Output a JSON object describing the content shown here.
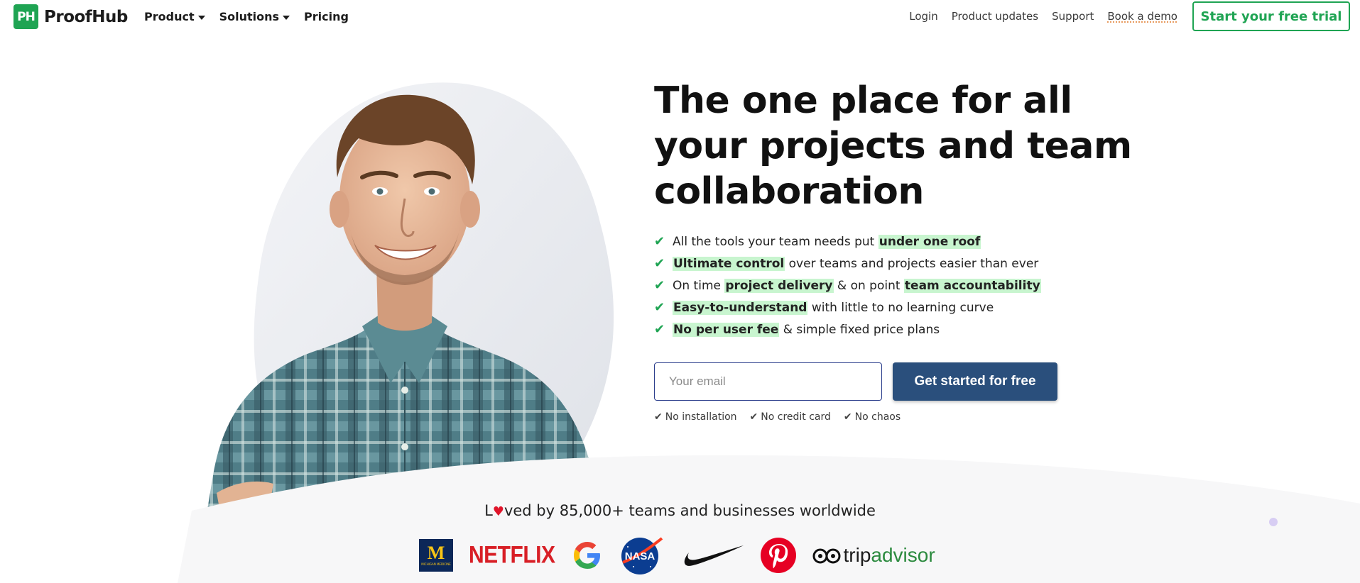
{
  "header": {
    "logo_mark": "PH",
    "logo_text": "ProofHub",
    "nav_left": [
      {
        "label": "Product",
        "has_menu": true
      },
      {
        "label": "Solutions",
        "has_menu": true
      },
      {
        "label": "Pricing",
        "has_menu": false
      }
    ],
    "nav_right": [
      "Login",
      "Product updates",
      "Support",
      "Book a demo"
    ],
    "trial_button": "Start your free trial"
  },
  "hero": {
    "headline": "The one place for all your projects and team collaboration",
    "features": [
      {
        "parts": [
          {
            "t": "All the tools your team needs put ",
            "hl": false
          },
          {
            "t": "under one roof",
            "hl": true
          }
        ]
      },
      {
        "parts": [
          {
            "t": "Ultimate control",
            "hl": true
          },
          {
            "t": " over teams and projects easier than ever",
            "hl": false
          }
        ]
      },
      {
        "parts": [
          {
            "t": "On time ",
            "hl": false
          },
          {
            "t": "project delivery",
            "hl": true
          },
          {
            "t": " & on point ",
            "hl": false
          },
          {
            "t": "team accountability",
            "hl": true
          }
        ]
      },
      {
        "parts": [
          {
            "t": "Easy-to-understand",
            "hl": true
          },
          {
            "t": " with little to no learning curve",
            "hl": false
          }
        ]
      },
      {
        "parts": [
          {
            "t": "No per user fee",
            "hl": true
          },
          {
            "t": " & simple fixed price plans",
            "hl": false
          }
        ]
      }
    ],
    "email_placeholder": "Your email",
    "cta_button": "Get started for free",
    "perks": [
      "No installation",
      "No credit card",
      "No chaos"
    ]
  },
  "social_proof": {
    "loved_prefix": "L",
    "loved_suffix": "ved by 85,000+ teams and businesses worldwide",
    "logos": {
      "umich_letter": "M",
      "umich_sub": "MICHIGAN MEDICINE",
      "netflix": "NETFLIX",
      "tripadvisor_a": "trip",
      "tripadvisor_b": "advisor"
    }
  },
  "colors": {
    "brand_green": "#1fa453",
    "highlight": "#c8f5cf",
    "cta_blue": "#2a4f7c",
    "heading": "#111111"
  }
}
